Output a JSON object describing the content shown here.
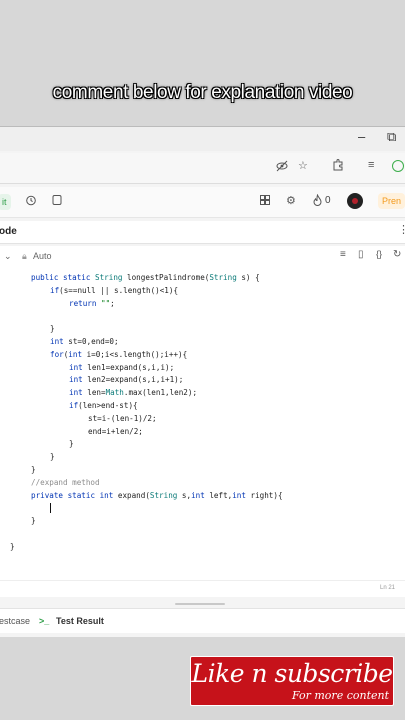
{
  "caption": "comment below for explanation video",
  "window": {
    "minimize_glyph": "–",
    "maximize_glyph": "⧉"
  },
  "address_bar": {
    "icons": [
      "eye-off-icon",
      "star-icon",
      "extensions-icon",
      "reading-list-icon",
      "profile-icon"
    ]
  },
  "toolbar": {
    "submit_label": "it",
    "counter": "0",
    "premium_label": "Pren"
  },
  "panel": {
    "title": "ode",
    "language": "Auto"
  },
  "code_lines": [
    "public static String longestPalindrome(String s) {",
    "    if(s==null || s.length()<1){",
    "        return \"\";",
    "",
    "    }",
    "    int st=0,end=0;",
    "    for(int i=0;i<s.length();i++){",
    "        int len1=expand(s,i,i);",
    "        int len2=expand(s,i,i+1);",
    "        int len=Math.max(len1,len2);",
    "        if(len>end-st){",
    "            st=i-(len-1)/2;",
    "            end=i+len/2;",
    "        }",
    "    }",
    "}",
    "//expand method",
    "private static int expand(String s,int left,int right){",
    "    ",
    "}",
    "",
    "}"
  ],
  "status": {
    "position": "Ln 21"
  },
  "bottom_tabs": {
    "testcase_label": "estcase",
    "result_label": "Test Result"
  },
  "subscribe": {
    "title": "Like n subscribe",
    "note": "For more content"
  },
  "colors": {
    "subscribe_red": "#c6121a",
    "premium_orange": "#f39a1e",
    "keyword_blue": "#0033b3"
  }
}
